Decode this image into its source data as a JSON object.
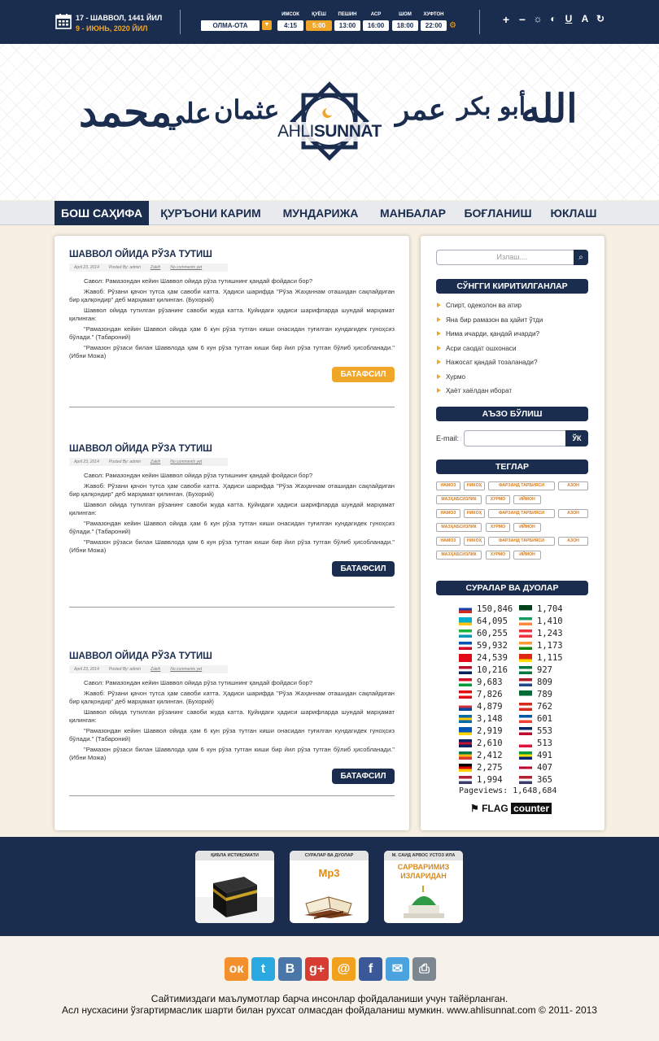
{
  "topbar": {
    "hijri_date": "17 - ШАВВОЛ, 1441 ЙИЛ",
    "greg_date": "9 - ИЮНЬ, 2020 ЙИЛ",
    "city": "ОЛМА-ОТА",
    "prayers": [
      {
        "name": "ИМСОК",
        "time": "4:15"
      },
      {
        "name": "ҚУЁШ",
        "time": "5:00"
      },
      {
        "name": "ПЕШИН",
        "time": "13:00"
      },
      {
        "name": "АСР",
        "time": "16:00"
      },
      {
        "name": "ШОМ",
        "time": "18:00"
      },
      {
        "name": "ХУФТОН",
        "time": "22:00"
      }
    ],
    "accessibility": [
      "+",
      "−",
      "☼",
      "◐",
      "U",
      "A",
      "↻"
    ]
  },
  "header": {
    "logo_a": "AHLI",
    "logo_b": "SUNNAT",
    "calligraphy": [
      "محمد",
      "علي",
      "عثمان",
      "عمر",
      "أبو بكر",
      "الله"
    ]
  },
  "nav": [
    "БОШ САҲИФА",
    "ҚУРЪОНИ КАРИМ",
    "МУНДАРИЖА",
    "МАНБАЛАР",
    "БОҒЛАНИШ",
    "ЮКЛАШ"
  ],
  "posts": [
    {
      "title": "ШАВВОЛ ОЙИДА РЎЗА ТУТИШ",
      "date": "April 23, 2014",
      "author": "Posted By: admin",
      "category": "Zakih",
      "comments": "No comments yet",
      "paragraphs": [
        "Савол: Рамазондан кейин Шаввол ойида рўза тутишнинг қандай фойдаси бор?",
        "Жавоб: Рўзани қачон тутса ҳам савоби катта. Ҳадиси шарифда \"Рўза Жаҳаннам оташидан сақлайдиган бир қалқондир\" деб марҳамат қилинган. (Бухорий)",
        "Шаввол ойида тутилган рўзанинг савоби жуда катта. Қуйидаги ҳадиси шарифларда шундай марҳамат қилинган:",
        "\"Рамазондан кейин Шаввол ойида ҳам 6 кун рўза тутган киши онасидан туғилган кундагидек гуноҳсиз бўлади.\" (Табароний)",
        "\"Рамазон рўзаси билан Шаввлода ҳам 6 кун рўза тутган киши бир йил рўза тутган бўлиб ҳисобланади.\" (Ибни Можа)"
      ],
      "more": "БАТАФСИЛ"
    },
    {
      "title": "ШАВВОЛ ОЙИДА РЎЗА ТУТИШ",
      "date": "April 23, 2014",
      "author": "Posted By: admin",
      "category": "Zakih",
      "comments": "No comments yet",
      "paragraphs": [
        "Савол: Рамазондан кейин Шаввол ойида рўза тутишнинг қандай фойдаси бор?",
        "Жавоб: Рўзани қачон тутса ҳам савоби катта. Ҳадиси шарифда \"Рўза Жаҳаннам оташидан сақлайдиган бир қалқондир\" деб марҳамат қилинган. (Бухорий)",
        "Шаввол ойида тутилган рўзанинг савоби жуда катта. Қуйидаги ҳадиси шарифларда шундай марҳамат қилинган:",
        "\"Рамазондан кейин Шаввол ойида ҳам 6 кун рўза тутган киши онасидан туғилган кундагидек гуноҳсиз бўлади.\" (Табароний)",
        "\"Рамазон рўзаси билан Шаввлода ҳам 6 кун рўза тутган киши бир йил рўза тутган бўлиб ҳисобланади.\" (Ибни Можа)"
      ],
      "more": "БАТАФСИЛ"
    },
    {
      "title": "ШАВВОЛ ОЙИДА РЎЗА ТУТИШ",
      "date": "April 23, 2014",
      "author": "Posted By: admin",
      "category": "Zakih",
      "comments": "No comments yet",
      "paragraphs": [
        "Савол: Рамазондан кейин Шаввол ойида рўза тутишнинг қандай фойдаси бор?",
        "Жавоб: Рўзани қачон тутса ҳам савоби катта. Ҳадиси шарифда \"Рўза Жаҳаннам оташидан сақлайдиган бир қалқондир\" деб марҳамат қилинган. (Бухорий)",
        "Шаввол ойида тутилган рўзанинг савоби жуда катта. Қуйидаги ҳадиси шарифларда шундай марҳамат қилинган:",
        "\"Рамазондан кейин Шаввол ойида ҳам 6 кун рўза тутган киши онасидан туғилган кундагидек гуноҳсиз бўлади.\" (Табароний)",
        "\"Рамазон рўзаси билан Шаввлода ҳам 6 кун рўза тутган киши бир йил рўза тутган бўлиб ҳисобланади.\" (Ибни Можа)"
      ],
      "more": "БАТАФСИЛ"
    }
  ],
  "sidebar": {
    "search_placeholder": "Излаш....",
    "recent_title": "СЎНГГИ КИРИТИЛГАНЛАР",
    "recent": [
      "Спирт, одеколон ва атир",
      "Яна бир рамазон ва ҳайит ўтди",
      "Нима ичарди, қандай ичарди?",
      "Асри саодат ошхонаси",
      "Нажосат қандай тозаланади?",
      "Хурмо",
      "Ҳаёт хаёлдан иборат"
    ],
    "subscribe_title": "АЪЗО БЎЛИШ",
    "email_label": "E-mail:",
    "email_button": "ЎК",
    "tags_title": "ТЕГЛАР",
    "tags": [
      "НАМОЗ",
      "НИКОҲ",
      "ФАРЗАНД ТАРБИЯСИ",
      "АЗОН",
      "МАЗҲАБСИЗЛИК",
      "ХУРМО",
      "ИЙМОН",
      "НАМОЗ",
      "НИКОҲ",
      "ФАРЗАНД ТАРБИЯСИ",
      "АЗОН",
      "МАЗҲАБСИЗЛИК",
      "ХУРМО",
      "ИЙМОН",
      "НАМОЗ",
      "НИКОҲ",
      "ФАРЗАНД ТАРБИЯСИ",
      "АЗОН",
      "МАЗҲАБСИЗЛИК",
      "ХУРМО",
      "ИЙМОН"
    ],
    "duas_title": "СУРАЛАР ВА ДУОЛАР",
    "flags_left": [
      {
        "v": "150,846",
        "c": [
          "#fff",
          "#1d3fae",
          "#d52b1e"
        ]
      },
      {
        "v": "64,095",
        "c": [
          "#00afca",
          "#00afca",
          "#fec50c"
        ]
      },
      {
        "v": "60,255",
        "c": [
          "#1eb53a",
          "#fff",
          "#0099b5"
        ]
      },
      {
        "v": "59,932",
        "c": [
          "#0052b4",
          "#fff",
          "#d80027"
        ]
      },
      {
        "v": "24,539",
        "c": [
          "#e30a17",
          "#e30a17",
          "#e30a17"
        ]
      },
      {
        "v": "10,216",
        "c": [
          "#ba0c2f",
          "#fff",
          "#00205b"
        ]
      },
      {
        "v": "9,683",
        "c": [
          "#ce1126",
          "#fff",
          "#009b3a"
        ]
      },
      {
        "v": "7,826",
        "c": [
          "#e30a17",
          "#fff",
          "#e30a17"
        ]
      },
      {
        "v": "4,879",
        "c": [
          "#fff",
          "#cd2e3a",
          "#0047a0"
        ]
      },
      {
        "v": "3,148",
        "c": [
          "#006aa7",
          "#fecc00",
          "#006aa7"
        ]
      },
      {
        "v": "2,919",
        "c": [
          "#0057b7",
          "#0057b7",
          "#ffd700"
        ]
      },
      {
        "v": "2,610",
        "c": [
          "#012169",
          "#c8102e",
          "#012169"
        ]
      },
      {
        "v": "2,412",
        "c": [
          "#007a4d",
          "#ffb612",
          "#de3831"
        ]
      },
      {
        "v": "2,275",
        "c": [
          "#000",
          "#dd0000",
          "#ffce00"
        ]
      },
      {
        "v": "1,994",
        "c": [
          "#b22234",
          "#fff",
          "#3c3b6e"
        ]
      }
    ],
    "flags_right": [
      {
        "v": "1,704",
        "c": [
          "#01411c",
          "#01411c",
          "#fff"
        ]
      },
      {
        "v": "1,410",
        "c": [
          "#169b62",
          "#fff",
          "#ff883e"
        ]
      },
      {
        "v": "1,243",
        "c": [
          "#ef3340",
          "#fff",
          "#ef3340"
        ]
      },
      {
        "v": "1,173",
        "c": [
          "#ff9933",
          "#fff",
          "#138808"
        ]
      },
      {
        "v": "1,115",
        "c": [
          "#de2910",
          "#de2910",
          "#ffde00"
        ]
      },
      {
        "v": "927",
        "c": [
          "#007a3d",
          "#fff",
          "#007a3d"
        ]
      },
      {
        "v": "809",
        "c": [
          "#ae1c28",
          "#fff",
          "#21468b"
        ]
      },
      {
        "v": "789",
        "c": [
          "#006c35",
          "#006c35",
          "#fff"
        ]
      },
      {
        "v": "762",
        "c": [
          "#d52b1e",
          "#fff",
          "#d52b1e"
        ]
      },
      {
        "v": "601",
        "c": [
          "#0055a4",
          "#fff",
          "#ef4135"
        ]
      },
      {
        "v": "553",
        "c": [
          "#002868",
          "#fff",
          "#bf0a30"
        ]
      },
      {
        "v": "513",
        "c": [
          "#fff",
          "#fff",
          "#dc143c"
        ]
      },
      {
        "v": "491",
        "c": [
          "#009c3b",
          "#ffdf00",
          "#002776"
        ]
      },
      {
        "v": "407",
        "c": [
          "#fff",
          "#bc002d",
          "#fff"
        ]
      },
      {
        "v": "365",
        "c": [
          "#b22234",
          "#fff",
          "#3c3b6e"
        ]
      }
    ],
    "pageviews_label": "Pageviews:",
    "pageviews": "1,648,684",
    "flagcounter_a": "FLAG",
    "flagcounter_b": "counter"
  },
  "footer": {
    "boxes": [
      {
        "title": "ҚИБЛА ИСТИҚОМАТИ"
      },
      {
        "title": "СУРАЛАР ВА ДУОЛАР",
        "label": "Mp3"
      },
      {
        "title": "М. САИД АРВОС УСТОЗ ИЛА",
        "label1": "САРВАРИМИЗ",
        "label2": "ИЗЛАРИДАН"
      }
    ],
    "social": [
      {
        "name": "odnoklassniki-icon",
        "glyph": "ок",
        "color": "#f4902b"
      },
      {
        "name": "twitter-icon",
        "glyph": "t",
        "color": "#2aa9e0"
      },
      {
        "name": "vk-icon",
        "glyph": "B",
        "color": "#4a76a8"
      },
      {
        "name": "google-plus-icon",
        "glyph": "g+",
        "color": "#d73d32"
      },
      {
        "name": "mail-icon",
        "glyph": "@",
        "color": "#f1a11e"
      },
      {
        "name": "facebook-icon",
        "glyph": "f",
        "color": "#3b5998"
      },
      {
        "name": "email-icon",
        "glyph": "✉",
        "color": "#4aa3df"
      },
      {
        "name": "print-icon",
        "glyph": "⎙",
        "color": "#7d8791"
      }
    ],
    "copy1": "Сайтимиздаги маълумотлар барча инсонлар фойдаланиши учун тайёрланган.",
    "copy2": "Асл нусхасини ўзгартирмаслик шарти билан рухсат олмасдан фойдаланиш мумкин. www.ahlisunnat.com © 2011- 2013"
  },
  "colors": {
    "navy": "#1b2d4f",
    "orange": "#f0a629"
  }
}
